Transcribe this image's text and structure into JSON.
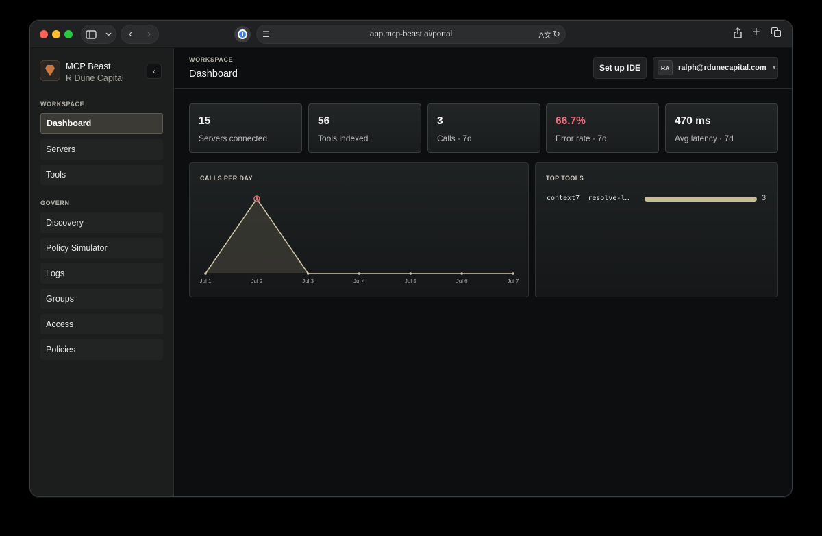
{
  "browser": {
    "url": "app.mcp-beast.ai/portal"
  },
  "sidebar": {
    "brand_name": "MCP Beast",
    "org_name": "R Dune Capital",
    "collapse_label": "‹",
    "sections": [
      {
        "label": "WORKSPACE",
        "items": [
          {
            "label": "Dashboard",
            "active": true
          },
          {
            "label": "Servers",
            "active": false
          },
          {
            "label": "Tools",
            "active": false
          }
        ]
      },
      {
        "label": "GOVERN",
        "items": [
          {
            "label": "Discovery",
            "active": false
          },
          {
            "label": "Policy Simulator",
            "active": false
          },
          {
            "label": "Logs",
            "active": false
          },
          {
            "label": "Groups",
            "active": false
          },
          {
            "label": "Access",
            "active": false
          },
          {
            "label": "Policies",
            "active": false
          }
        ]
      }
    ]
  },
  "header": {
    "crumb": "WORKSPACE",
    "title": "Dashboard",
    "setup_ide_label": "Set up IDE",
    "user_initials": "RA",
    "user_email": "ralph@rdunecapital.com"
  },
  "stats": [
    {
      "value": "15",
      "label": "Servers connected",
      "danger": false
    },
    {
      "value": "56",
      "label": "Tools indexed",
      "danger": false
    },
    {
      "value": "3",
      "label": "Calls · 7d",
      "danger": false
    },
    {
      "value": "66.7%",
      "label": "Error rate · 7d",
      "danger": true
    },
    {
      "value": "470 ms",
      "label": "Avg latency · 7d",
      "danger": false
    }
  ],
  "calls_panel": {
    "title": "CALLS PER DAY"
  },
  "chart_data": {
    "type": "area",
    "title": "CALLS PER DAY",
    "categories": [
      "Jul 1",
      "Jul 2",
      "Jul 3",
      "Jul 4",
      "Jul 5",
      "Jul 6",
      "Jul 7"
    ],
    "values": [
      0,
      3,
      0,
      0,
      0,
      0,
      0
    ],
    "ylim": [
      0,
      3
    ],
    "grid": false,
    "highlight_index": 1,
    "colors": {
      "line": "#cfc6a8",
      "fill": "#3a3832",
      "highlight": "#e0707c"
    }
  },
  "top_tools": {
    "title": "TOP TOOLS",
    "items": [
      {
        "name": "context7__resolve-l…",
        "count": "3",
        "fraction": 1.0
      }
    ]
  }
}
